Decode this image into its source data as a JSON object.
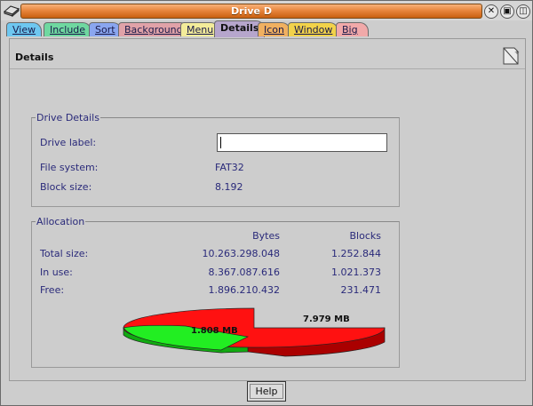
{
  "window": {
    "title": "Drive D"
  },
  "tabs": [
    {
      "label": "View",
      "color": "#6ec7f0"
    },
    {
      "label": "Include",
      "color": "#6fd8a0"
    },
    {
      "label": "Sort",
      "color": "#8aa6f0"
    },
    {
      "label": "Background",
      "color": "#e0a2a8"
    },
    {
      "label": "Menu",
      "color": "#f3ec9a"
    },
    {
      "label": "Details",
      "color": "#b6a6cc",
      "active": true
    },
    {
      "label": "Icon",
      "color": "#f0b060"
    },
    {
      "label": "Window",
      "color": "#f2d24a"
    },
    {
      "label": "Big icon",
      "color": "#f1a9a9"
    }
  ],
  "panel": {
    "title": "Details"
  },
  "drive_details": {
    "legend": "Drive Details",
    "label_label": "Drive label:",
    "label_value": "",
    "fs_label": "File system:",
    "fs_value": "FAT32",
    "block_label": "Block size:",
    "block_value": "8.192"
  },
  "allocation": {
    "legend": "Allocation",
    "col_bytes": "Bytes",
    "col_blocks": "Blocks",
    "rows": [
      {
        "label": "Total size:",
        "bytes": "10.263.298.048",
        "blocks": "1.252.844"
      },
      {
        "label": "In use:",
        "bytes": "8.367.087.616",
        "blocks": "1.021.373"
      },
      {
        "label": "Free:",
        "bytes": "1.896.210.432",
        "blocks": "231.471"
      }
    ],
    "pie": {
      "free_label": "1.808 MB",
      "used_label": "7.979 MB",
      "free_color": "#22ee22",
      "used_color": "#ff1111"
    }
  },
  "buttons": {
    "help": "Help"
  }
}
